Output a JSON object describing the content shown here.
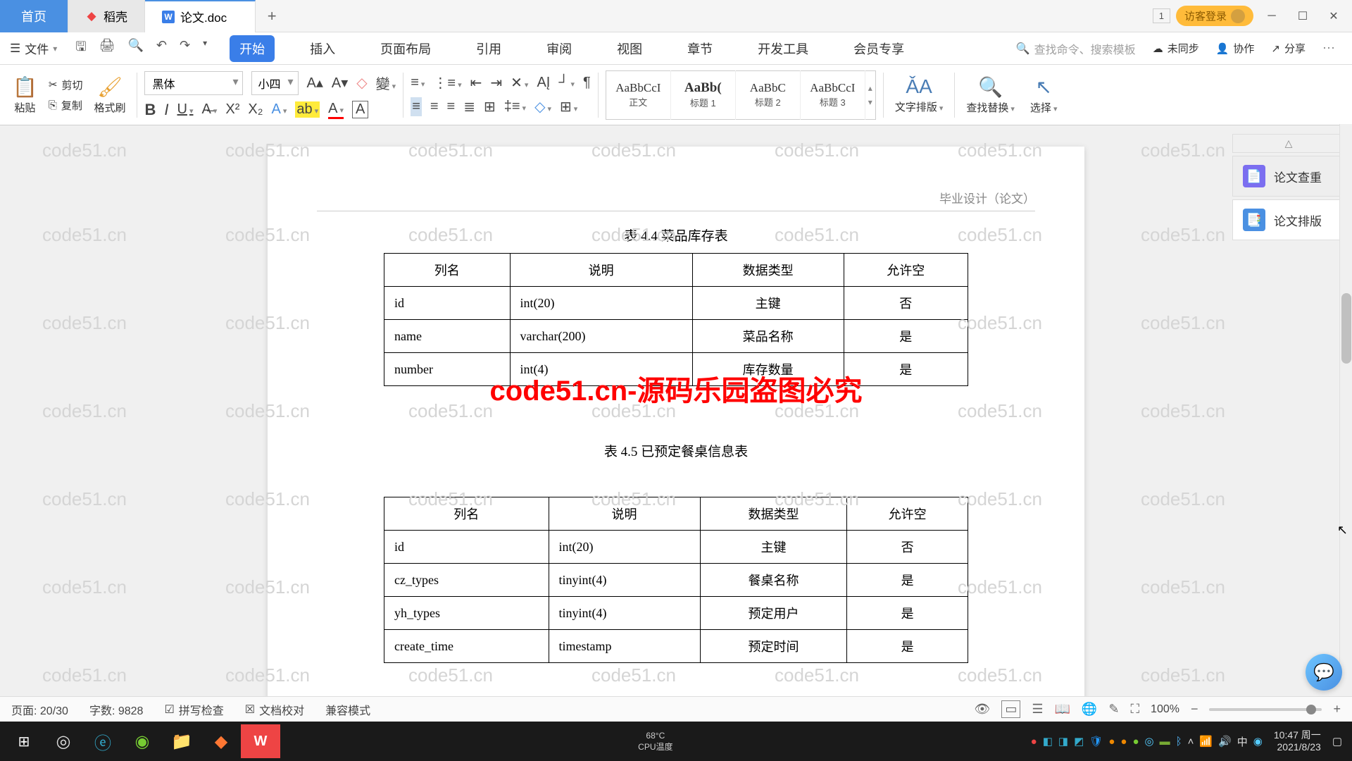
{
  "tabs": {
    "home": "首页",
    "t1": "稻壳",
    "t2": "论文.doc"
  },
  "titlebar": {
    "pages": "1",
    "login": "访客登录"
  },
  "file_menu": "文件",
  "menu": {
    "start": "开始",
    "insert": "插入",
    "page": "页面布局",
    "ref": "引用",
    "review": "审阅",
    "view": "视图",
    "chapter": "章节",
    "dev": "开发工具",
    "member": "会员专享"
  },
  "menubar_right": {
    "search": "查找命令、搜索模板",
    "unsync": "未同步",
    "collab": "协作",
    "share": "分享"
  },
  "ribbon": {
    "paste": "粘贴",
    "cut": "剪切",
    "copy": "复制",
    "format": "格式刷",
    "font_name": "黑体",
    "font_size": "小四",
    "styles": {
      "body": "正文",
      "h1": "标题 1",
      "h2": "标题 2",
      "h3": "标题 3",
      "preview": "AaBbCcI",
      "preview_h": "AaBb(",
      "preview_h2": "AaBbC",
      "preview_h3": "AaBbCcI"
    },
    "typeset": "文字排版",
    "findrep": "查找替换",
    "select": "选择"
  },
  "doc": {
    "header": "毕业设计（论文）",
    "t44_caption": "表 4.4  菜品库存表",
    "t45_caption": "表 4.5  已预定餐桌信息表",
    "th": {
      "col": "列名",
      "desc": "说明",
      "type": "数据类型",
      "null": "允许空"
    },
    "t44": [
      {
        "col": "id",
        "desc": "int(20)",
        "type": "主键",
        "null": "否"
      },
      {
        "col": "name",
        "desc": "varchar(200)",
        "type": "菜品名称",
        "null": "是"
      },
      {
        "col": "number",
        "desc": "int(4)",
        "type": "库存数量",
        "null": "是"
      }
    ],
    "t45": [
      {
        "col": "id",
        "desc": "int(20)",
        "type": "主键",
        "null": "否"
      },
      {
        "col": "cz_types",
        "desc": "tinyint(4)",
        "type": "餐桌名称",
        "null": "是"
      },
      {
        "col": "yh_types",
        "desc": "tinyint(4)",
        "type": "预定用户",
        "null": "是"
      },
      {
        "col": "create_time",
        "desc": "timestamp",
        "type": "预定时间",
        "null": "是"
      }
    ],
    "watermark": "code51.cn-源码乐园盗图必究",
    "bgwm": "code51.cn"
  },
  "panel": {
    "check": "论文查重",
    "layout": "论文排版"
  },
  "status": {
    "page": "页面: 20/30",
    "words": "字数: 9828",
    "spell": "拼写检查",
    "proof": "文档校对",
    "compat": "兼容模式",
    "zoom": "100%"
  },
  "taskbar": {
    "temp": "68°C",
    "templbl": "CPU温度",
    "time": "10:47 周一",
    "date": "2021/8/23"
  }
}
